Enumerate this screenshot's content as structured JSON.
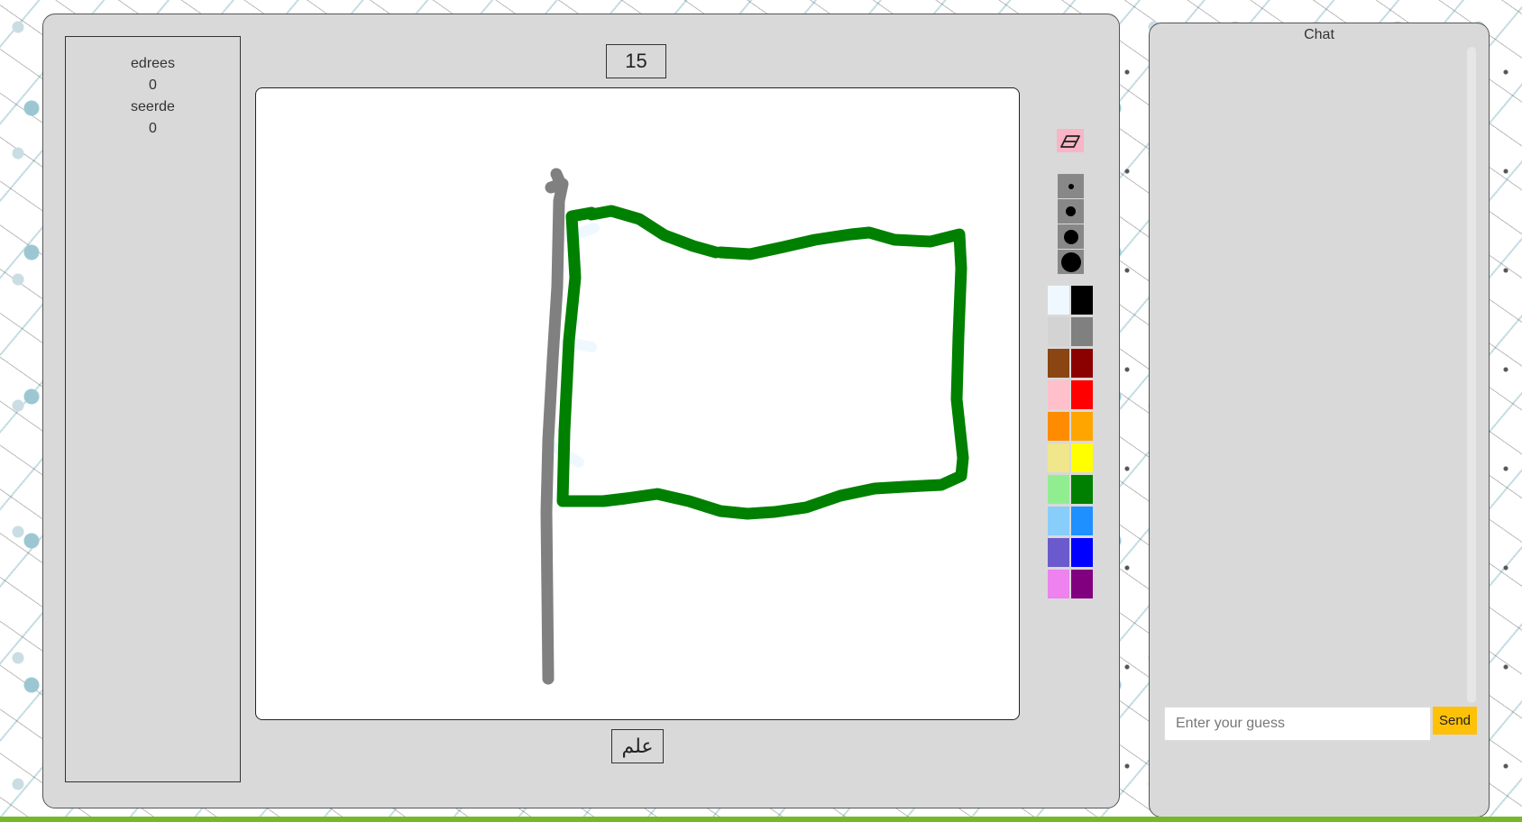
{
  "timer": {
    "seconds": "15"
  },
  "players": [
    {
      "name": "edrees",
      "score": "0"
    },
    {
      "name": "seerde",
      "score": "0"
    }
  ],
  "word": "علم",
  "tools": {
    "eraser_icon": "eraser-icon",
    "brush_sizes": [
      "small",
      "medium",
      "large",
      "x-large"
    ]
  },
  "palette": [
    {
      "name": "alice-blue",
      "color": "#f0f8ff"
    },
    {
      "name": "black",
      "color": "#000000"
    },
    {
      "name": "light-gray",
      "color": "#d3d3d3"
    },
    {
      "name": "gray",
      "color": "#808080"
    },
    {
      "name": "saddle-brown",
      "color": "#8b4513"
    },
    {
      "name": "dark-red",
      "color": "#8b0000"
    },
    {
      "name": "pink",
      "color": "#ffc0cb"
    },
    {
      "name": "red",
      "color": "#ff0000"
    },
    {
      "name": "dark-orange",
      "color": "#ff8c00"
    },
    {
      "name": "orange",
      "color": "#ffa500"
    },
    {
      "name": "khaki",
      "color": "#f0e68c"
    },
    {
      "name": "yellow",
      "color": "#ffff00"
    },
    {
      "name": "light-green",
      "color": "#90ee90"
    },
    {
      "name": "green",
      "color": "#008000"
    },
    {
      "name": "light-sky-blue",
      "color": "#87cefa"
    },
    {
      "name": "dodger-blue",
      "color": "#1e90ff"
    },
    {
      "name": "slate-blue",
      "color": "#6a5acd"
    },
    {
      "name": "blue",
      "color": "#0000ff"
    },
    {
      "name": "violet",
      "color": "#ee82ee"
    },
    {
      "name": "purple",
      "color": "#800080"
    }
  ],
  "drawing": {
    "pole_color": "#808080",
    "flag_color": "#008000",
    "rope_color": "#f0f8ff"
  },
  "chat": {
    "title": "Chat",
    "input_placeholder": "Enter your guess",
    "send_label": "Send"
  },
  "colors": {
    "panel_bg": "#d9d9d9",
    "send_button": "#ffc107",
    "footer_strip": "#76b82a"
  }
}
